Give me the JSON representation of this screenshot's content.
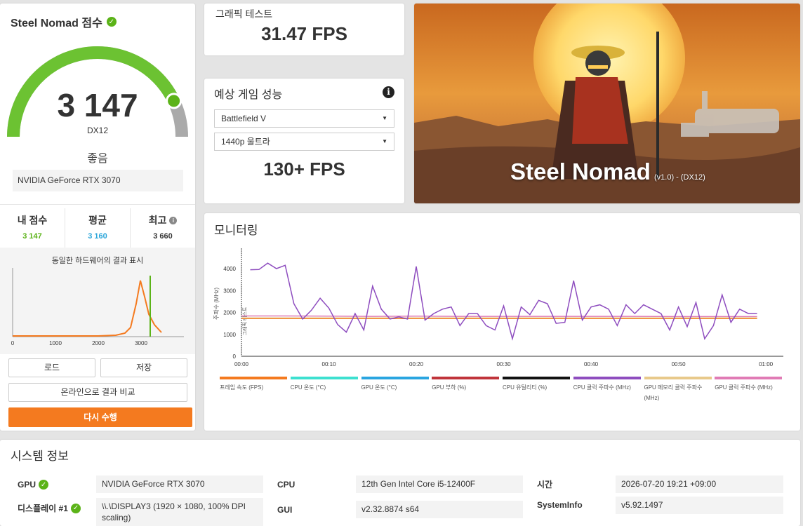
{
  "score": {
    "title": "Steel Nomad 점수",
    "value": "3 147",
    "api": "DX12",
    "rating": "좋음",
    "gpu": "NVIDIA GeForce RTX 3070",
    "gauge_fraction": 0.86,
    "stats": [
      {
        "label": "내 점수",
        "value": "3 147",
        "color": "#5bb318"
      },
      {
        "label": "평균",
        "value": "3 160",
        "color": "#2aa5d9"
      },
      {
        "label": "최고",
        "value": "3 660",
        "color": "#333333"
      }
    ]
  },
  "distribution": {
    "title": "동일한 하드웨어의 결과 표시",
    "x_ticks": [
      "0",
      "1000",
      "2000",
      "3000"
    ]
  },
  "buttons": {
    "load": "로드",
    "save": "저장",
    "compare": "온라인으로 결과 비교",
    "rerun": "다시 수행"
  },
  "graphics_test": {
    "label": "그래픽 테스트",
    "value": "31.47 FPS"
  },
  "game_perf": {
    "title": "예상 게임 성능",
    "game": "Battlefield V",
    "quality": "1440p 울트라",
    "fps": "130+ FPS"
  },
  "hero": {
    "title": "Steel Nomad",
    "version": "(v1.0) - (DX12)"
  },
  "monitoring": {
    "title": "모니터링",
    "legend": [
      {
        "label": "프레임 속도 (FPS)",
        "color": "#f47a1f"
      },
      {
        "label": "CPU 온도 (°C)",
        "color": "#3de0d0"
      },
      {
        "label": "GPU 온도 (°C)",
        "color": "#2aa5e0"
      },
      {
        "label": "GPU 부하 (%)",
        "color": "#c0343b"
      },
      {
        "label": "CPU 유틸리티 (%)",
        "color": "#111111"
      },
      {
        "label": "CPU 클럭 주파수 (MHz)",
        "color": "#8e4dbf"
      },
      {
        "label": "GPU 메모리 클럭 주파수 (MHz)",
        "color": "#e8c98a"
      },
      {
        "label": "GPU 클럭 주파수 (MHz)",
        "color": "#e07bb5"
      }
    ]
  },
  "chart_data": {
    "type": "line",
    "ylabel": "주파수 (MHz)",
    "secondary_label": "그래픽 테스트",
    "y_ticks": [
      0,
      1000,
      2000,
      3000,
      4000
    ],
    "ylim": [
      0,
      4800
    ],
    "x_ticks": [
      "00:00",
      "00:10",
      "00:20",
      "00:30",
      "00:40",
      "00:50",
      "01:00"
    ],
    "xlim": [
      0,
      62
    ],
    "series": [
      {
        "name": "CPU 클럭 주파수 (MHz)",
        "color": "#8e4dbf",
        "x": [
          1,
          2,
          3,
          4,
          5,
          6,
          7,
          8,
          9,
          10,
          11,
          12,
          13,
          14,
          15,
          16,
          17,
          18,
          19,
          20,
          21,
          22,
          23,
          24,
          25,
          26,
          27,
          28,
          29,
          30,
          31,
          32,
          33,
          34,
          35,
          36,
          37,
          38,
          39,
          40,
          41,
          42,
          43,
          44,
          45,
          46,
          47,
          48,
          49,
          50,
          51,
          52,
          53,
          54,
          55,
          56,
          57,
          58,
          59
        ],
        "y": [
          3950,
          3960,
          4250,
          4000,
          4150,
          2400,
          1700,
          2100,
          2650,
          2200,
          1450,
          1100,
          1950,
          1200,
          3200,
          2150,
          1700,
          1800,
          1700,
          4100,
          1650,
          1950,
          2150,
          2250,
          1400,
          1950,
          1950,
          1400,
          1200,
          2300,
          800,
          2250,
          1900,
          2550,
          2400,
          1500,
          1550,
          3450,
          1650,
          2250,
          2350,
          2150,
          1400,
          2350,
          1950,
          2350,
          2150,
          1950,
          1200,
          2250,
          1350,
          2450,
          800,
          1400,
          2800,
          1550,
          2150,
          1950,
          1950
        ]
      },
      {
        "name": "GPU 클럭 주파수 (MHz)",
        "color": "#e07bb5",
        "x": [
          0,
          5,
          10,
          15,
          20,
          25,
          30,
          35,
          40,
          45,
          50,
          55,
          59
        ],
        "y": [
          1840,
          1840,
          1830,
          1820,
          1830,
          1820,
          1820,
          1820,
          1820,
          1820,
          1810,
          1810,
          1810
        ]
      },
      {
        "name": "GPU 메모리 클럭 주파수 (MHz)",
        "color": "#e8c98a",
        "x": [
          0,
          59
        ],
        "y": [
          1750,
          1750
        ]
      },
      {
        "name": "프레임 속도 (FPS)",
        "color": "#f47a1f",
        "x": [
          0,
          59
        ],
        "y": [
          1720,
          1720
        ]
      }
    ]
  },
  "system_info": {
    "title": "시스템 정보",
    "gpu_label": "GPU",
    "gpu_value": "NVIDIA GeForce RTX 3070",
    "display_label": "디스플레이 #1",
    "display_value": "\\\\.\\DISPLAY3 (1920 × 1080, 100% DPI scaling)",
    "cpu_label": "CPU",
    "cpu_value": "12th Gen Intel Core i5-12400F",
    "gui_label": "GUI",
    "gui_value": "v2.32.8874 s64",
    "time_label": "시간",
    "time_value": "2026-07-20 19:21 +09:00",
    "sysinfo_label": "SystemInfo",
    "sysinfo_value": "v5.92.1497"
  },
  "icons": [
    "check-icon",
    "info-icon",
    "caret-down-icon"
  ]
}
